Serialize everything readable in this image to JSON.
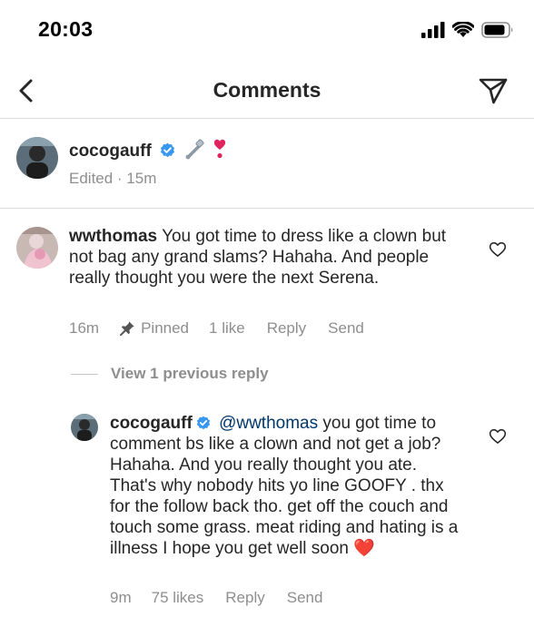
{
  "status_bar": {
    "time": "20:03"
  },
  "header": {
    "title": "Comments"
  },
  "caption": {
    "username": "cocogauff",
    "edited": "Edited · 15m",
    "icons": [
      "verified-icon",
      "safety-pin-icon",
      "exclamation-heart-icon"
    ]
  },
  "comment1": {
    "username": "wwthomas",
    "text": "You got time to dress like a clown but not bag any grand slams? Hahaha. And people really thought you were the next Serena.",
    "time": "16m",
    "pinned": "Pinned",
    "likes": "1 like",
    "reply": "Reply",
    "send": "Send"
  },
  "view_previous": "View 1 previous reply",
  "reply1": {
    "username": "cocogauff",
    "mention": "@wwthomas",
    "text": "you got time to comment bs like a clown and not get a job? Hahaha. And you really thought you ate. That's why nobody hits yo line GOOFY . thx for the follow back tho. get off the couch and touch some grass. meat riding and hating is a illness I hope you get well soon",
    "emoji": "❤️",
    "time": "9m",
    "likes": "75 likes",
    "reply": "Reply",
    "send": "Send"
  },
  "colors": {
    "verified": "#3897f0",
    "link": "#00376b",
    "heart_emoji": "#e0245e"
  }
}
